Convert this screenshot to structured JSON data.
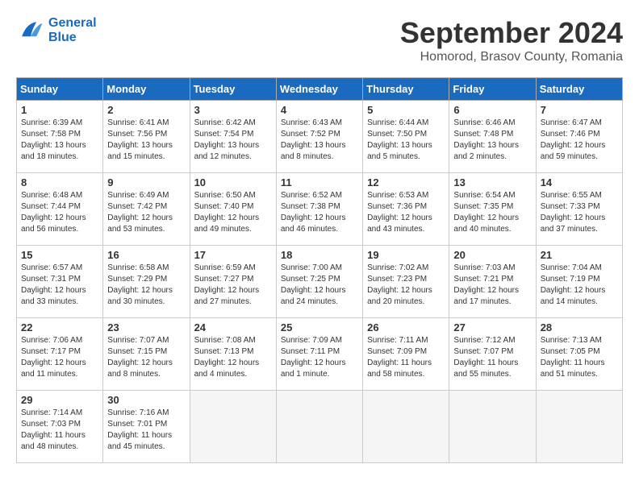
{
  "header": {
    "logo_line1": "General",
    "logo_line2": "Blue",
    "month": "September 2024",
    "location": "Homorod, Brasov County, Romania"
  },
  "weekdays": [
    "Sunday",
    "Monday",
    "Tuesday",
    "Wednesday",
    "Thursday",
    "Friday",
    "Saturday"
  ],
  "days": [
    {
      "num": "",
      "sunrise": "",
      "sunset": "",
      "daylight": ""
    },
    {
      "num": "",
      "sunrise": "",
      "sunset": "",
      "daylight": ""
    },
    {
      "num": "",
      "sunrise": "",
      "sunset": "",
      "daylight": ""
    },
    {
      "num": "",
      "sunrise": "",
      "sunset": "",
      "daylight": ""
    },
    {
      "num": "",
      "sunrise": "",
      "sunset": "",
      "daylight": ""
    },
    {
      "num": "",
      "sunrise": "",
      "sunset": "",
      "daylight": ""
    },
    {
      "num": "7",
      "sunrise": "Sunrise: 6:47 AM",
      "sunset": "Sunset: 7:46 PM",
      "daylight": "Daylight: 12 hours and 59 minutes."
    },
    {
      "num": "8",
      "sunrise": "Sunrise: 6:48 AM",
      "sunset": "Sunset: 7:44 PM",
      "daylight": "Daylight: 12 hours and 56 minutes."
    },
    {
      "num": "9",
      "sunrise": "Sunrise: 6:49 AM",
      "sunset": "Sunset: 7:42 PM",
      "daylight": "Daylight: 12 hours and 53 minutes."
    },
    {
      "num": "10",
      "sunrise": "Sunrise: 6:50 AM",
      "sunset": "Sunset: 7:40 PM",
      "daylight": "Daylight: 12 hours and 49 minutes."
    },
    {
      "num": "11",
      "sunrise": "Sunrise: 6:52 AM",
      "sunset": "Sunset: 7:38 PM",
      "daylight": "Daylight: 12 hours and 46 minutes."
    },
    {
      "num": "12",
      "sunrise": "Sunrise: 6:53 AM",
      "sunset": "Sunset: 7:36 PM",
      "daylight": "Daylight: 12 hours and 43 minutes."
    },
    {
      "num": "13",
      "sunrise": "Sunrise: 6:54 AM",
      "sunset": "Sunset: 7:35 PM",
      "daylight": "Daylight: 12 hours and 40 minutes."
    },
    {
      "num": "14",
      "sunrise": "Sunrise: 6:55 AM",
      "sunset": "Sunset: 7:33 PM",
      "daylight": "Daylight: 12 hours and 37 minutes."
    },
    {
      "num": "15",
      "sunrise": "Sunrise: 6:57 AM",
      "sunset": "Sunset: 7:31 PM",
      "daylight": "Daylight: 12 hours and 33 minutes."
    },
    {
      "num": "16",
      "sunrise": "Sunrise: 6:58 AM",
      "sunset": "Sunset: 7:29 PM",
      "daylight": "Daylight: 12 hours and 30 minutes."
    },
    {
      "num": "17",
      "sunrise": "Sunrise: 6:59 AM",
      "sunset": "Sunset: 7:27 PM",
      "daylight": "Daylight: 12 hours and 27 minutes."
    },
    {
      "num": "18",
      "sunrise": "Sunrise: 7:00 AM",
      "sunset": "Sunset: 7:25 PM",
      "daylight": "Daylight: 12 hours and 24 minutes."
    },
    {
      "num": "19",
      "sunrise": "Sunrise: 7:02 AM",
      "sunset": "Sunset: 7:23 PM",
      "daylight": "Daylight: 12 hours and 20 minutes."
    },
    {
      "num": "20",
      "sunrise": "Sunrise: 7:03 AM",
      "sunset": "Sunset: 7:21 PM",
      "daylight": "Daylight: 12 hours and 17 minutes."
    },
    {
      "num": "21",
      "sunrise": "Sunrise: 7:04 AM",
      "sunset": "Sunset: 7:19 PM",
      "daylight": "Daylight: 12 hours and 14 minutes."
    },
    {
      "num": "22",
      "sunrise": "Sunrise: 7:06 AM",
      "sunset": "Sunset: 7:17 PM",
      "daylight": "Daylight: 12 hours and 11 minutes."
    },
    {
      "num": "23",
      "sunrise": "Sunrise: 7:07 AM",
      "sunset": "Sunset: 7:15 PM",
      "daylight": "Daylight: 12 hours and 8 minutes."
    },
    {
      "num": "24",
      "sunrise": "Sunrise: 7:08 AM",
      "sunset": "Sunset: 7:13 PM",
      "daylight": "Daylight: 12 hours and 4 minutes."
    },
    {
      "num": "25",
      "sunrise": "Sunrise: 7:09 AM",
      "sunset": "Sunset: 7:11 PM",
      "daylight": "Daylight: 12 hours and 1 minute."
    },
    {
      "num": "26",
      "sunrise": "Sunrise: 7:11 AM",
      "sunset": "Sunset: 7:09 PM",
      "daylight": "Daylight: 11 hours and 58 minutes."
    },
    {
      "num": "27",
      "sunrise": "Sunrise: 7:12 AM",
      "sunset": "Sunset: 7:07 PM",
      "daylight": "Daylight: 11 hours and 55 minutes."
    },
    {
      "num": "28",
      "sunrise": "Sunrise: 7:13 AM",
      "sunset": "Sunset: 7:05 PM",
      "daylight": "Daylight: 11 hours and 51 minutes."
    },
    {
      "num": "29",
      "sunrise": "Sunrise: 7:14 AM",
      "sunset": "Sunset: 7:03 PM",
      "daylight": "Daylight: 11 hours and 48 minutes."
    },
    {
      "num": "30",
      "sunrise": "Sunrise: 7:16 AM",
      "sunset": "Sunset: 7:01 PM",
      "daylight": "Daylight: 11 hours and 45 minutes."
    }
  ],
  "row1": [
    {
      "num": "1",
      "sunrise": "Sunrise: 6:39 AM",
      "sunset": "Sunset: 7:58 PM",
      "daylight": "Daylight: 13 hours and 18 minutes."
    },
    {
      "num": "2",
      "sunrise": "Sunrise: 6:41 AM",
      "sunset": "Sunset: 7:56 PM",
      "daylight": "Daylight: 13 hours and 15 minutes."
    },
    {
      "num": "3",
      "sunrise": "Sunrise: 6:42 AM",
      "sunset": "Sunset: 7:54 PM",
      "daylight": "Daylight: 13 hours and 12 minutes."
    },
    {
      "num": "4",
      "sunrise": "Sunrise: 6:43 AM",
      "sunset": "Sunset: 7:52 PM",
      "daylight": "Daylight: 13 hours and 8 minutes."
    },
    {
      "num": "5",
      "sunrise": "Sunrise: 6:44 AM",
      "sunset": "Sunset: 7:50 PM",
      "daylight": "Daylight: 13 hours and 5 minutes."
    },
    {
      "num": "6",
      "sunrise": "Sunrise: 6:46 AM",
      "sunset": "Sunset: 7:48 PM",
      "daylight": "Daylight: 13 hours and 2 minutes."
    },
    {
      "num": "7",
      "sunrise": "Sunrise: 6:47 AM",
      "sunset": "Sunset: 7:46 PM",
      "daylight": "Daylight: 12 hours and 59 minutes."
    }
  ]
}
